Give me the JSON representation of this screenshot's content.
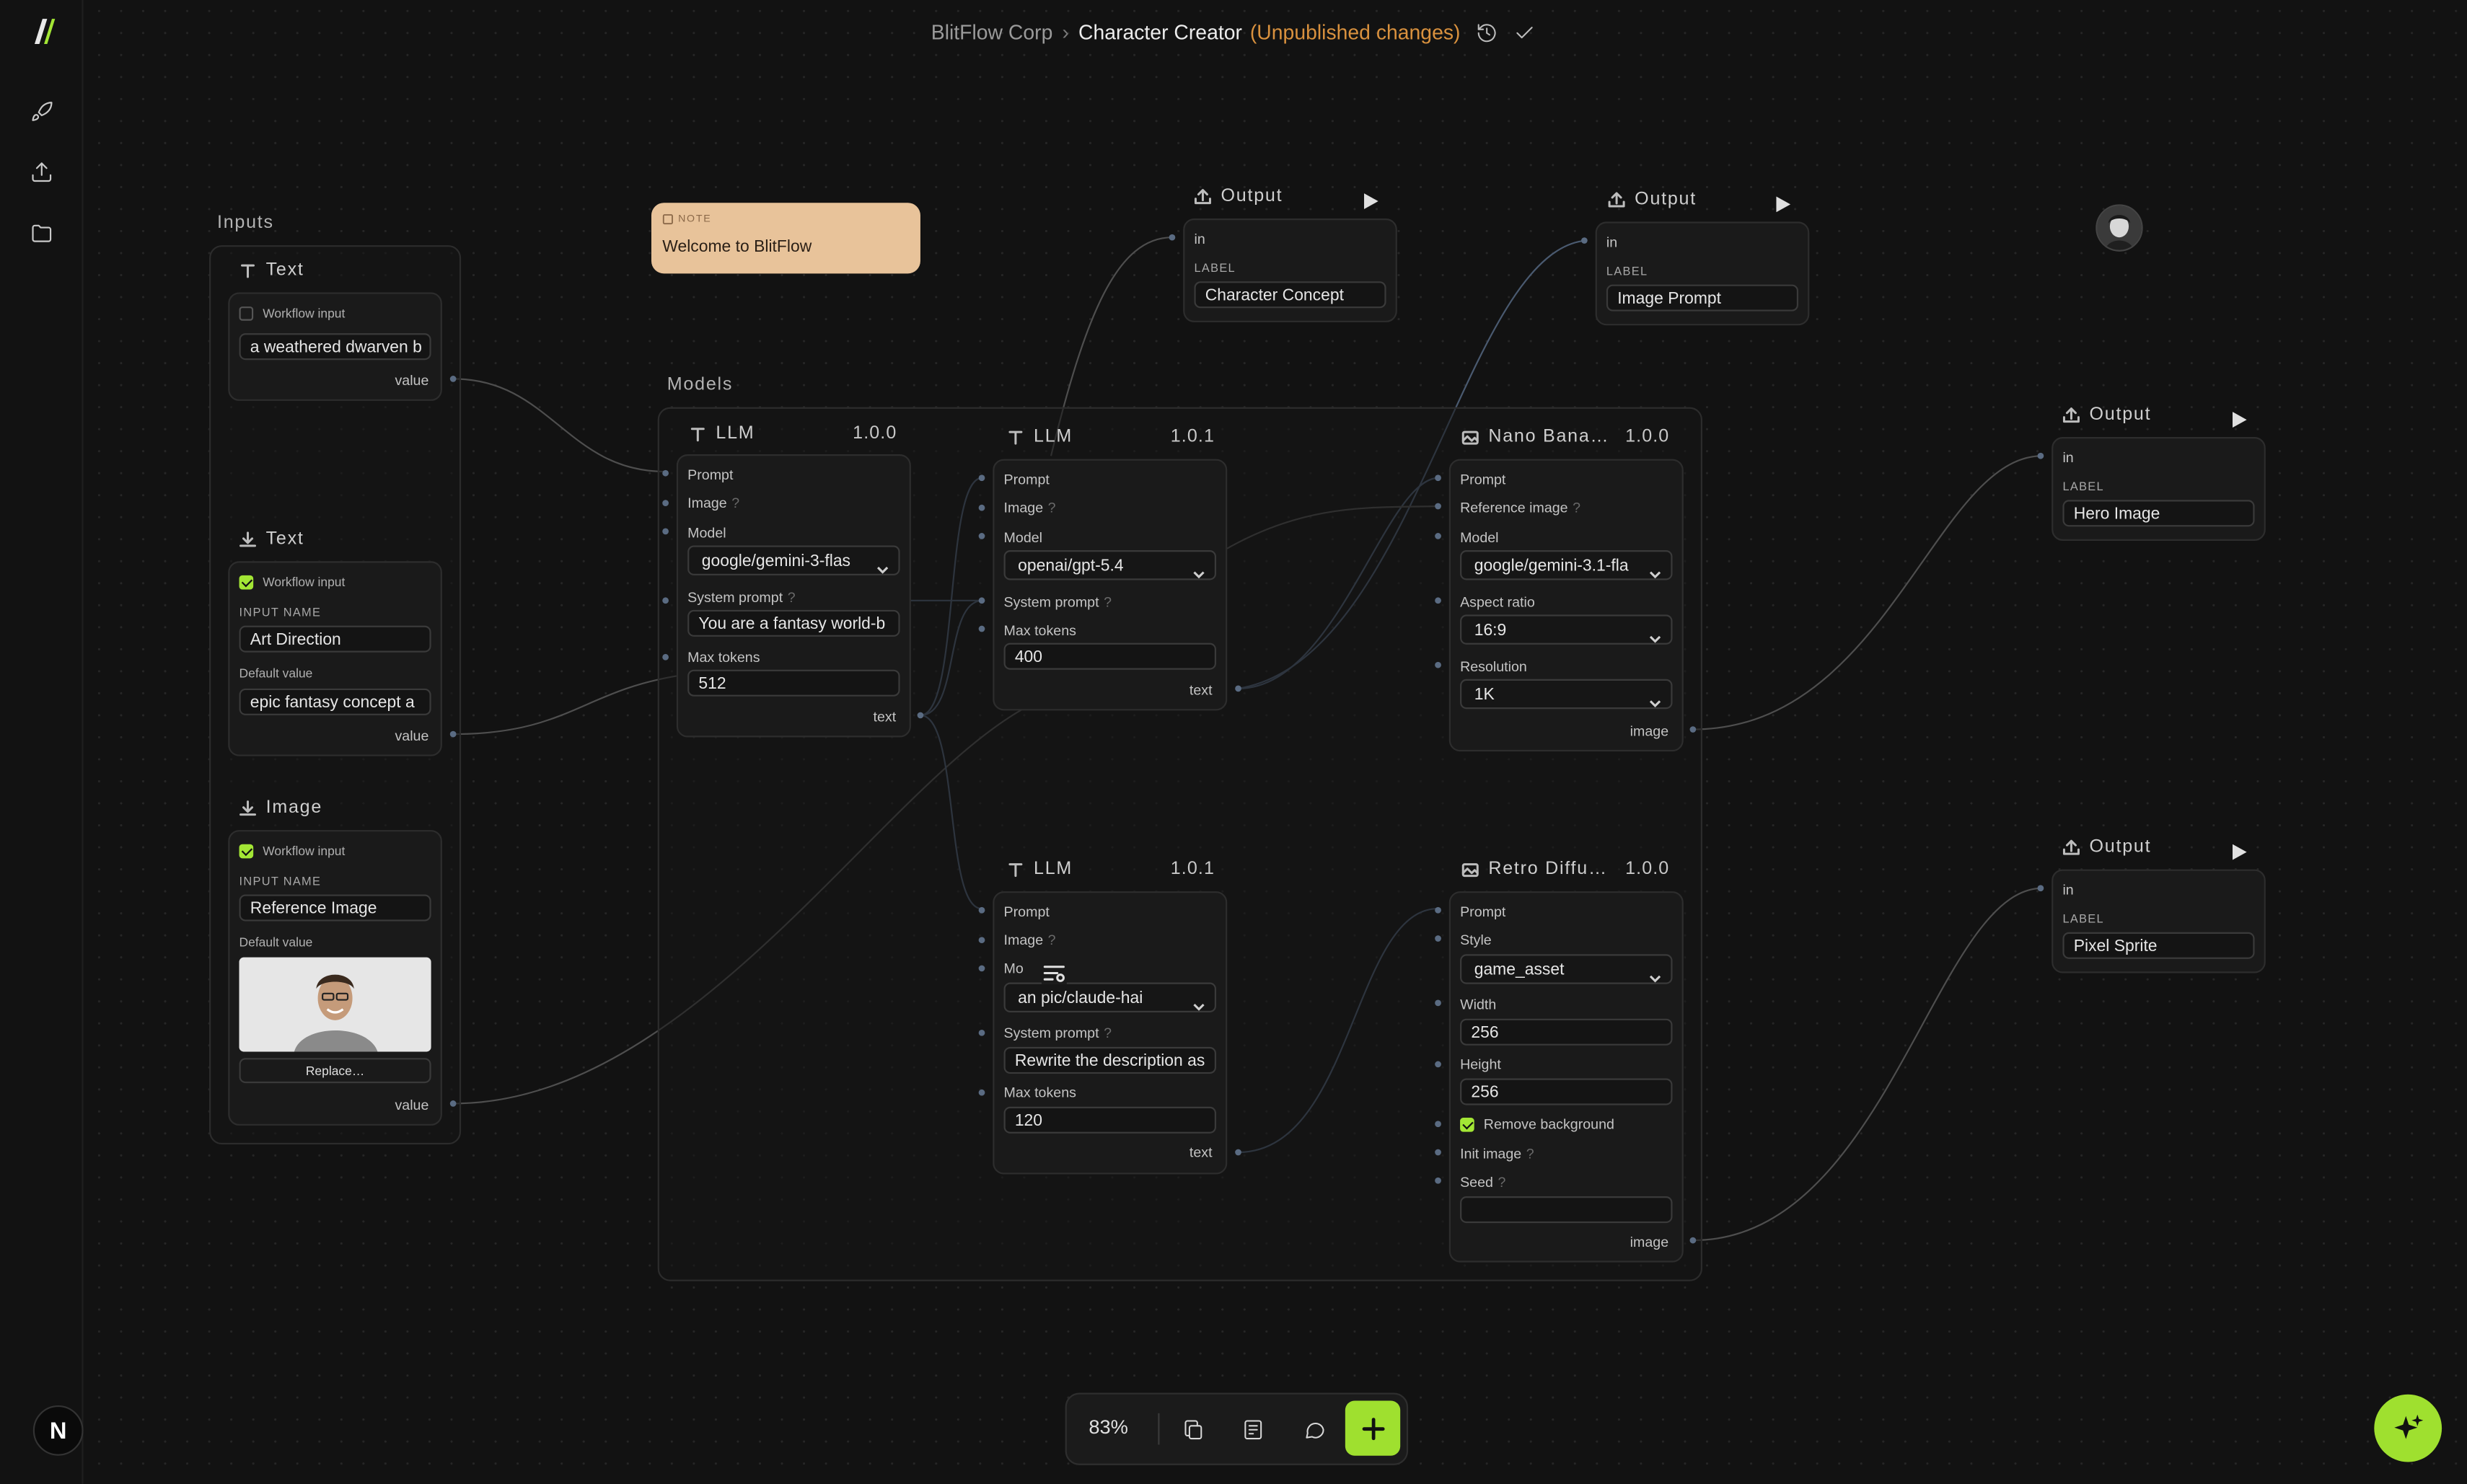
{
  "header": {
    "org": "BlitFlow Corp",
    "page": "Character Creator",
    "status": "(Unpublished changes)"
  },
  "note": {
    "tag": "NOTE",
    "text": "Welcome to BlitFlow"
  },
  "inputs_group": {
    "label": "Inputs",
    "text1": {
      "title": "Text",
      "workflow_input": "Workflow input",
      "value": "a weathered dwarven b",
      "port": "value"
    },
    "text2": {
      "title": "Text",
      "workflow_input": "Workflow input",
      "input_name_label": "INPUT NAME",
      "input_name": "Art Direction",
      "default_label": "Default value",
      "default_value": "epic fantasy concept a",
      "port": "value"
    },
    "image": {
      "title": "Image",
      "workflow_input": "Workflow input",
      "input_name_label": "INPUT NAME",
      "input_name": "Reference Image",
      "default_label": "Default value",
      "replace": "Replace…",
      "port": "value"
    }
  },
  "models_group": {
    "label": "Models",
    "llm1": {
      "title": "LLM",
      "version": "1.0.0",
      "prompt": "Prompt",
      "image": "Image",
      "model_label": "Model",
      "model": "google/gemini-3-flas",
      "system_label": "System prompt",
      "system": "You are a fantasy world-b",
      "max_label": "Max tokens",
      "max": "512",
      "out": "text"
    },
    "llm2": {
      "title": "LLM",
      "version": "1.0.1",
      "prompt": "Prompt",
      "image": "Image",
      "model_label": "Model",
      "model": "openai/gpt-5.4",
      "system_label": "System prompt",
      "max_label": "Max tokens",
      "max": "400",
      "out": "text"
    },
    "llm3": {
      "title": "LLM",
      "version": "1.0.1",
      "prompt": "Prompt",
      "image": "Image",
      "model_label": "Mo",
      "model": "an    pic/claude-hai",
      "system_label": "System prompt",
      "system": "Rewrite the description as",
      "max_label": "Max tokens",
      "max": "120",
      "out": "text"
    },
    "nano": {
      "title": "Nano Bana…",
      "version": "1.0.0",
      "prompt": "Prompt",
      "ref": "Reference image",
      "model_label": "Model",
      "model": "google/gemini-3.1-fla",
      "aspect_label": "Aspect ratio",
      "aspect": "16:9",
      "res_label": "Resolution",
      "res": "1K",
      "out": "image"
    },
    "retro": {
      "title": "Retro Diffu…",
      "version": "1.0.0",
      "prompt": "Prompt",
      "style_label": "Style",
      "style": "game_asset",
      "width_label": "Width",
      "width": "256",
      "height_label": "Height",
      "height": "256",
      "remove_bg": "Remove background",
      "init": "Init image",
      "seed_label": "Seed",
      "seed": "",
      "out": "image"
    }
  },
  "outputs": [
    {
      "title": "Output",
      "in": "in",
      "label_caption": "LABEL",
      "label": "Character Concept"
    },
    {
      "title": "Output",
      "in": "in",
      "label_caption": "LABEL",
      "label": "Image Prompt"
    },
    {
      "title": "Output",
      "in": "in",
      "label_caption": "LABEL",
      "label": "Hero Image"
    },
    {
      "title": "Output",
      "in": "in",
      "label_caption": "LABEL",
      "label": "Pixel Sprite"
    }
  ],
  "toolbar": {
    "zoom": "83%"
  },
  "rail": {
    "avatar": "N"
  },
  "icons": [
    "logo-icon",
    "rocket-icon",
    "upload-icon",
    "folder-icon",
    "history-icon",
    "check-icon",
    "text-type-icon",
    "download-icon",
    "image-icon",
    "play-icon",
    "chevron-down-icon",
    "note-icon",
    "copy-icon",
    "notes-icon",
    "comment-icon",
    "plus-icon",
    "sparkle-icon",
    "filter-icon"
  ],
  "colors": {
    "accent": "#9fe02f",
    "status": "#d9913e",
    "note": "#e8c39a",
    "background": "#121212"
  }
}
